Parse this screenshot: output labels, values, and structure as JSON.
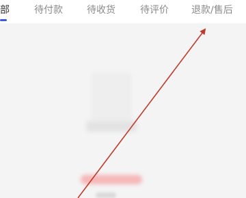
{
  "tabs": [
    {
      "label": "部",
      "active": true
    },
    {
      "label": "待付款",
      "active": false
    },
    {
      "label": "待收货",
      "active": false
    },
    {
      "label": "待评价",
      "active": false
    },
    {
      "label": "退款/售后",
      "active": false
    }
  ],
  "colors": {
    "accent": "#3b5bdb",
    "annotation_arrow": "#c0392b",
    "button_tint": "#f6b8b8"
  }
}
